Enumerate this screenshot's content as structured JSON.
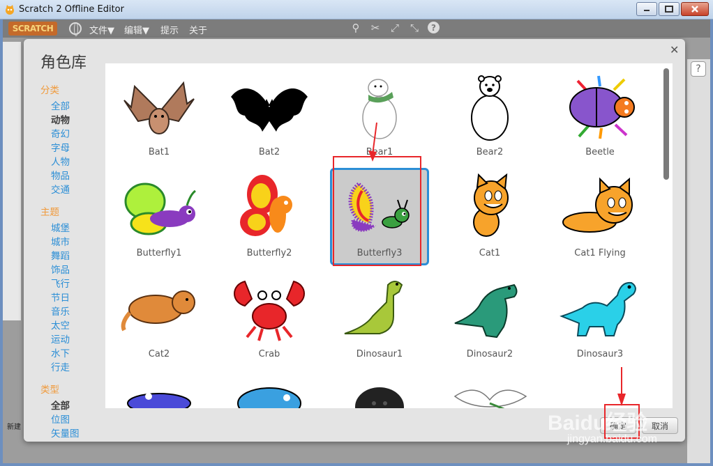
{
  "window": {
    "title": "Scratch 2 Offline Editor"
  },
  "menubar": {
    "logo": "SCRATCH",
    "items": [
      "文件▼",
      "编辑▼",
      "提示",
      "关于"
    ]
  },
  "dialog": {
    "title": "角色库",
    "sections": [
      {
        "heading": "分类",
        "items": [
          "全部",
          "动物",
          "奇幻",
          "字母",
          "人物",
          "物品",
          "交通"
        ],
        "active": "动物"
      },
      {
        "heading": "主题",
        "items": [
          "城堡",
          "城市",
          "舞蹈",
          "饰品",
          "飞行",
          "节日",
          "音乐",
          "太空",
          "运动",
          "水下",
          "行走"
        ]
      },
      {
        "heading": "类型",
        "items": [
          "全部",
          "位图",
          "矢量图"
        ],
        "active": "全部"
      }
    ],
    "sprites": [
      "Bat1",
      "Bat2",
      "Bear1",
      "Bear2",
      "Beetle",
      "Butterfly1",
      "Butterfly2",
      "Butterfly3",
      "Cat1",
      "Cat1 Flying",
      "Cat2",
      "Crab",
      "Dinosaur1",
      "Dinosaur2",
      "Dinosaur3"
    ],
    "selected_sprite": "Butterfly3",
    "ok_label": "确定",
    "cancel_label": "取消"
  },
  "left_pane": {
    "label": "新建"
  },
  "watermark": {
    "brand": "Baidu经验",
    "url": "jingyan.baidu.com"
  },
  "colors": {
    "accent": "#2b8ed6",
    "section": "#f09a3c",
    "annotation": "#e8262a"
  }
}
